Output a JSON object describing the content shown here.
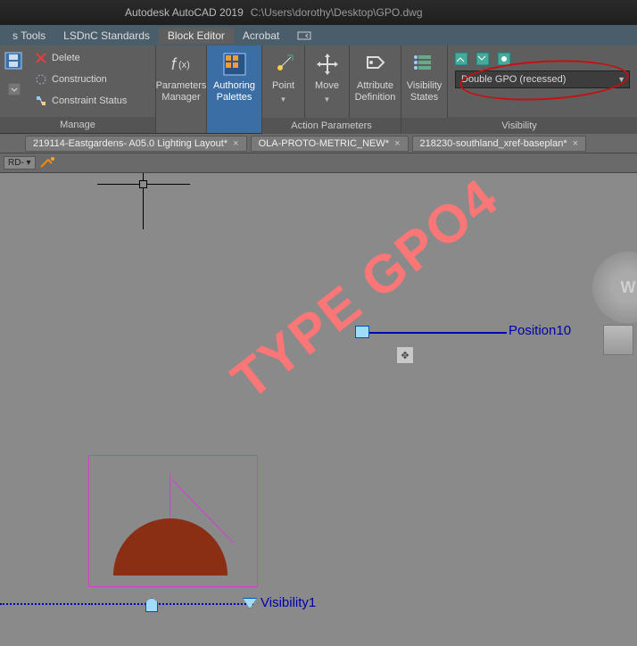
{
  "title": {
    "app": "Autodesk AutoCAD 2019",
    "path": "C:\\Users\\dorothy\\Desktop\\GPO.dwg"
  },
  "menu": {
    "items": [
      "s Tools",
      "LSDnC Standards",
      "Block Editor",
      "Acrobat"
    ],
    "active_index": 2
  },
  "ribbon": {
    "manage": {
      "delete": "Delete",
      "construction": "Construction",
      "constraint": "Constraint Status",
      "title": "Manage"
    },
    "params_mgr": {
      "l1": "Parameters",
      "l2": "Manager"
    },
    "auth_pal": {
      "l1": "Authoring",
      "l2": "Palettes"
    },
    "point": {
      "l1": "Point"
    },
    "move": {
      "l1": "Move"
    },
    "attr_def": {
      "l1": "Attribute",
      "l2": "Definition"
    },
    "vis_states": {
      "l1": "Visibility",
      "l2": "States"
    },
    "action_title": "Action Parameters",
    "vis_title": "Visibility",
    "vis_dropdown": "Double GPO (recessed)"
  },
  "tabs": [
    "219114-Eastgardens- A05.0 Lighting Layout*",
    "OLA-PROTO-METRIC_NEW*",
    "218230-southland_xref-baseplan*"
  ],
  "toolrow": {
    "sel": "RD-"
  },
  "canvas": {
    "watermark": "TYPE GPO4",
    "pos_label": "Position10",
    "vis_label": "Visibility1",
    "nav_w": "W"
  }
}
